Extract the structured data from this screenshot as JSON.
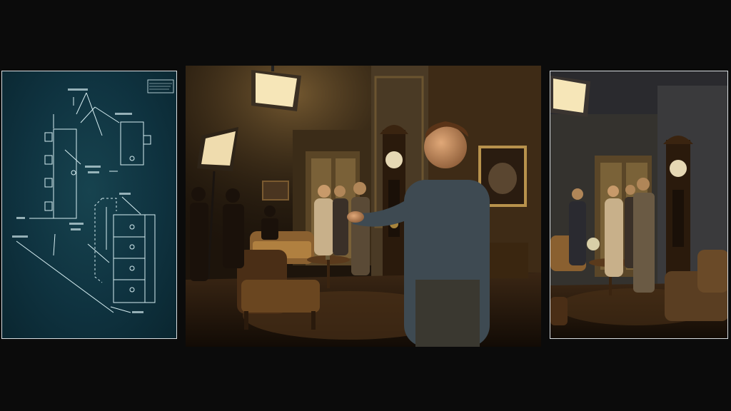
{
  "panels": {
    "blueprint": {
      "kind": "technical floor-plan sketch",
      "line_color": "#d7eef2",
      "paper_color": "#0f3340"
    },
    "set_main": {
      "kind": "film set scene",
      "key_light": "#f6e6b8",
      "wall_color": "#4a3a22"
    },
    "set_wide": {
      "kind": "wide shot of period parlour set",
      "frame_color": "#d8dde0"
    }
  },
  "icons": [
    "softbox-light-icon",
    "grandfather-clock-icon",
    "framed-painting-icon",
    "armchair-icon",
    "sofa-icon",
    "side-table-icon",
    "flower-vase-icon"
  ]
}
